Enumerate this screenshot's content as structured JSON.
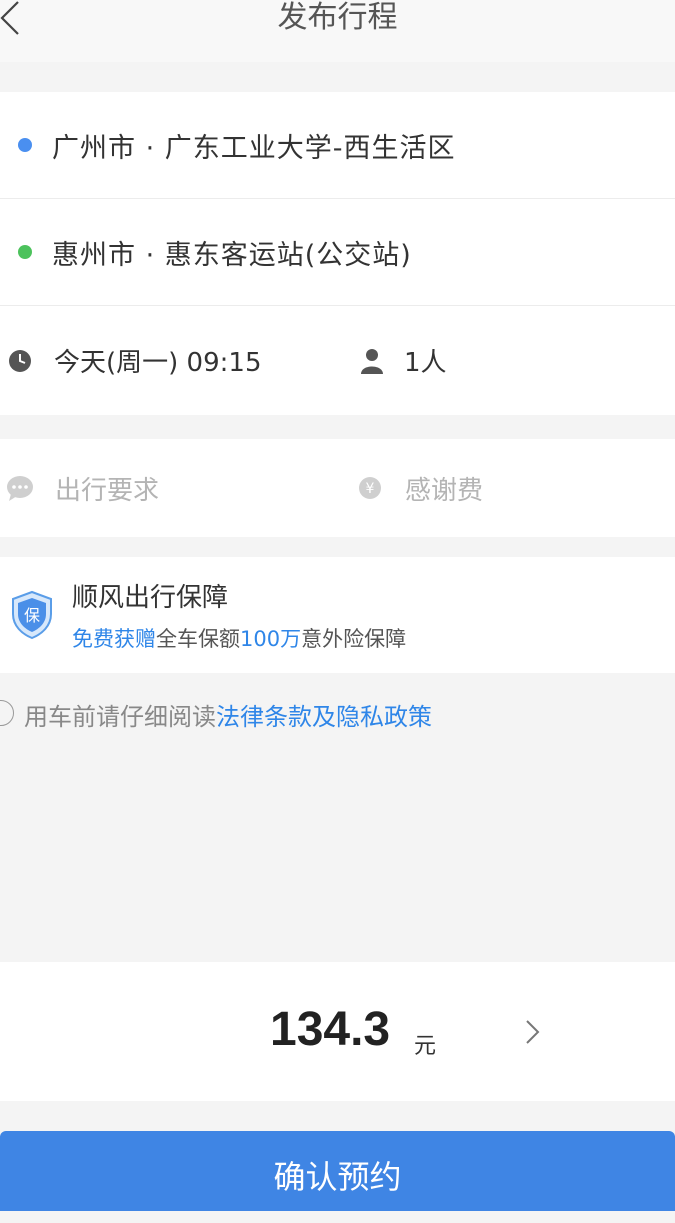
{
  "nav": {
    "title": "发布行程",
    "back_icon": "chevron-left-icon"
  },
  "route": {
    "origin": "广州市 · 广东工业大学-西生活区",
    "destination": "惠州市 · 惠东客运站(公交站)",
    "time": "今天(周一) 09:15",
    "passengers": "1人",
    "origin_dot_color": "#4a8ff0",
    "destination_dot_color": "#4cc25c"
  },
  "extras": {
    "requirements_placeholder": "出行要求",
    "fee_placeholder": "感谢费"
  },
  "insurance": {
    "title": "顺风出行保障",
    "badge": "保",
    "sub_part1": "免费获赠",
    "sub_part2": "全车保额",
    "sub_part3": "100万",
    "sub_part4": "意外险保障"
  },
  "agreement": {
    "prefix": "用车前请仔细阅读",
    "link": "法律条款及隐私政策"
  },
  "price": {
    "value": "134.3",
    "unit": "元"
  },
  "confirm": {
    "label": "确认预约",
    "color": "#3f85e4"
  }
}
